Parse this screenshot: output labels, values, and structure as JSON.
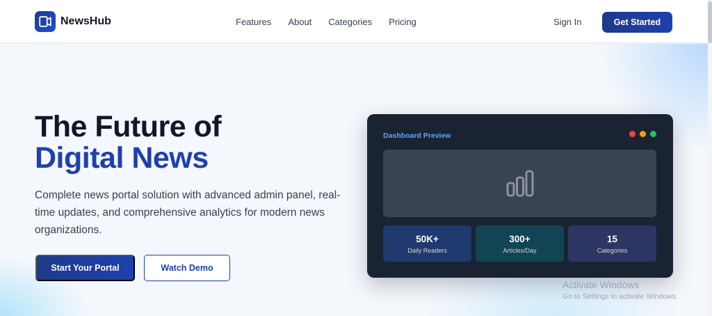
{
  "brand": {
    "name": "NewsHub",
    "accent": "#1e40af"
  },
  "nav": {
    "links": [
      {
        "label": "Features"
      },
      {
        "label": "About"
      },
      {
        "label": "Categories"
      },
      {
        "label": "Pricing"
      }
    ],
    "sign_in": "Sign In",
    "get_started": "Get Started"
  },
  "hero": {
    "headline_line1": "The Future of",
    "headline_line2": "Digital News",
    "subtitle": "Complete news portal solution with advanced admin panel, real-time updates, and comprehensive analytics for modern news organizations.",
    "primary_cta": "Start Your Portal",
    "secondary_cta": "Watch Demo"
  },
  "dashboard": {
    "title": "Dashboard Preview",
    "window_dots": [
      "#ef4444",
      "#f59e0b",
      "#22c55e"
    ],
    "preview_icon": "bar-chart-icon",
    "stats": [
      {
        "value": "50K+",
        "label": "Daily Readers",
        "bg": "#1e3a6e"
      },
      {
        "value": "300+",
        "label": "Articles/Day",
        "bg": "#124553"
      },
      {
        "value": "15",
        "label": "Categories",
        "bg": "#2d3663"
      }
    ]
  },
  "watermark": {
    "line1": "Activate Windows",
    "line2": "Go to Settings to activate Windows."
  }
}
